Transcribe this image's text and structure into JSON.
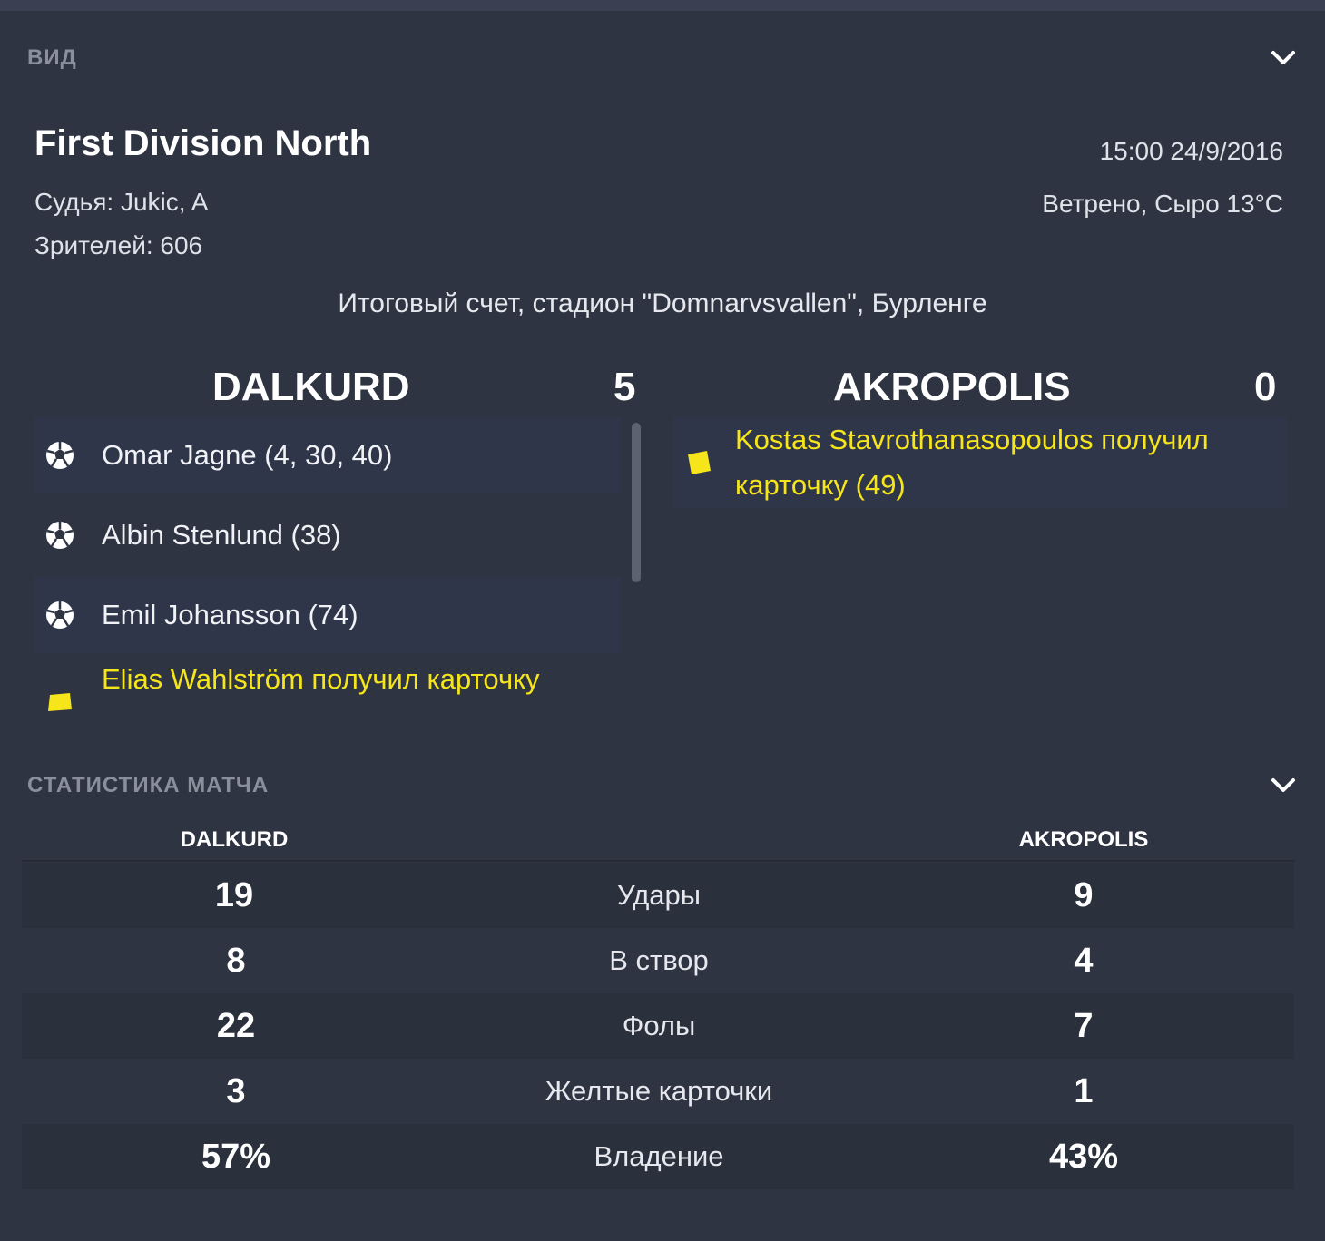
{
  "view_section": {
    "title": "ВИД"
  },
  "match_info": {
    "competition": "First Division North",
    "referee": "Судья: Jukic, A",
    "attendance": "Зрителей: 606",
    "datetime": "15:00 24/9/2016",
    "weather": "Ветрено, Сыро 13°C",
    "venue": "Итоговый счет, стадион \"Domnarvsvallen\", Бурленге"
  },
  "home": {
    "name": "DALKURD",
    "score": "5",
    "events": [
      {
        "type": "goal",
        "text": "Omar Jagne (4, 30, 40)"
      },
      {
        "type": "goal",
        "text": "Albin Stenlund (38)"
      },
      {
        "type": "goal",
        "text": "Emil Johansson (74)"
      },
      {
        "type": "yellow",
        "text": "Elias Wahlström получил карточку"
      }
    ]
  },
  "away": {
    "name": "AKROPOLIS",
    "score": "0",
    "events": [
      {
        "type": "yellow",
        "line1": "Kostas Stavrothanasopoulos получил",
        "line2": "карточку (49)"
      }
    ]
  },
  "stats_section": {
    "title": "СТАТИСТИКА МАТЧА",
    "home_team": "DALKURD",
    "away_team": "AKROPOLIS",
    "rows": [
      {
        "home": "19",
        "label": "Удары",
        "away": "9"
      },
      {
        "home": "8",
        "label": "В створ",
        "away": "4"
      },
      {
        "home": "22",
        "label": "Фолы",
        "away": "7"
      },
      {
        "home": "3",
        "label": "Желтые карточки",
        "away": "1"
      },
      {
        "home": "57%",
        "label": "Владение",
        "away": "43%"
      }
    ]
  },
  "colors": {
    "background": "#2f3442",
    "yellow_card": "#f5e51a",
    "text_muted": "#8a8f9c"
  }
}
